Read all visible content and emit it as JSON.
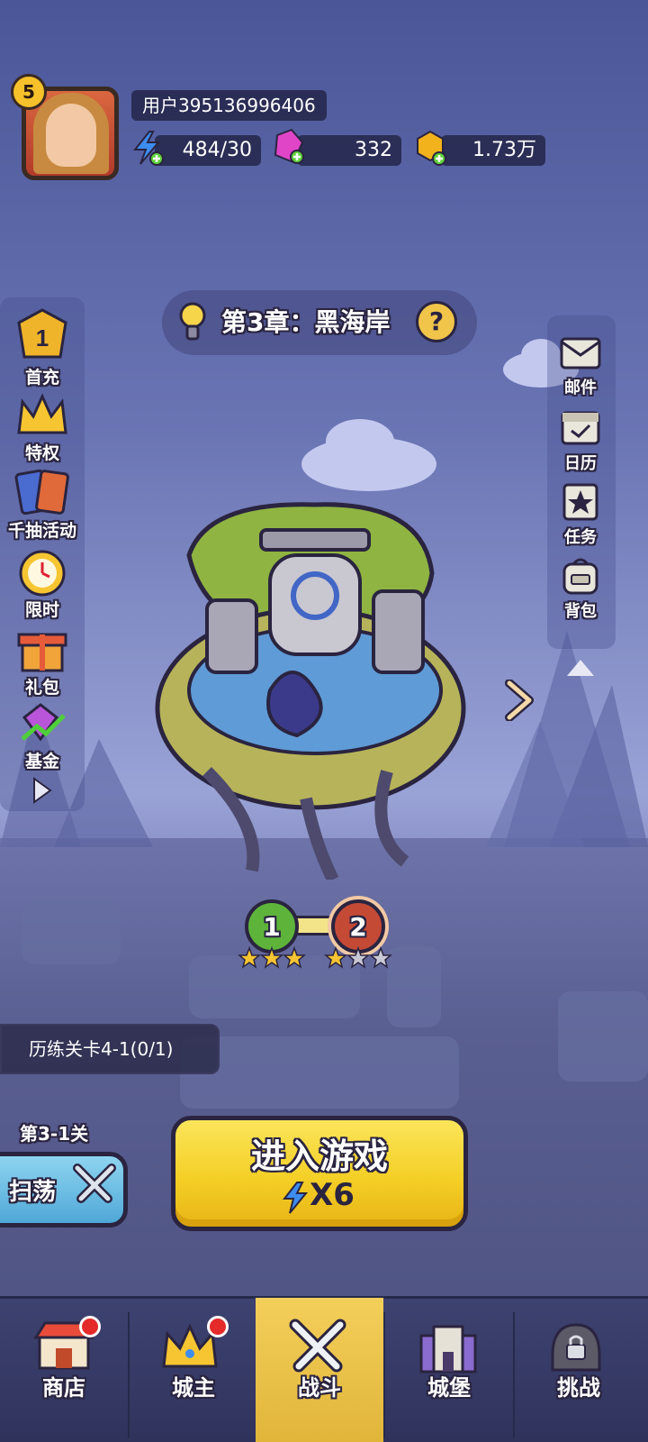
{
  "header": {
    "level": "5",
    "username": "用户395136996406",
    "energy": "484/30",
    "gems": "332",
    "gold": "1.73万"
  },
  "chapter": {
    "title": "第3章：黑海岸"
  },
  "left_menu": [
    {
      "label": "首充",
      "icon": "first-charge-icon"
    },
    {
      "label": "特权",
      "icon": "privilege-crown-icon"
    },
    {
      "label": "千抽活动",
      "icon": "card-draw-icon"
    },
    {
      "label": "限时",
      "icon": "clock-icon"
    },
    {
      "label": "礼包",
      "icon": "gift-icon"
    },
    {
      "label": "基金",
      "icon": "fund-gem-icon"
    }
  ],
  "right_menu": [
    {
      "label": "邮件",
      "icon": "mail-icon"
    },
    {
      "label": "日历",
      "icon": "calendar-icon"
    },
    {
      "label": "任务",
      "icon": "task-icon"
    },
    {
      "label": "背包",
      "icon": "backpack-icon"
    }
  ],
  "stages": [
    {
      "number": "1",
      "stars": 3
    },
    {
      "number": "2",
      "stars": 1
    }
  ],
  "quest": {
    "text": "历练关卡4-1(0/1)"
  },
  "current_stage": "第3-1关",
  "sweep_label": "扫荡",
  "enter_button": {
    "title": "进入游戏",
    "cost": "X6"
  },
  "bottom_nav": [
    {
      "label": "商店",
      "badge": true,
      "active": false
    },
    {
      "label": "城主",
      "badge": true,
      "active": false
    },
    {
      "label": "战斗",
      "badge": false,
      "active": true
    },
    {
      "label": "城堡",
      "badge": false,
      "active": false
    },
    {
      "label": "挑战",
      "badge": false,
      "active": false
    }
  ],
  "colors": {
    "accent_yellow": "#f4cf26",
    "active_tab": "#f3cf5a",
    "background": "#6a75b4",
    "badge_red": "#e52a2a"
  }
}
